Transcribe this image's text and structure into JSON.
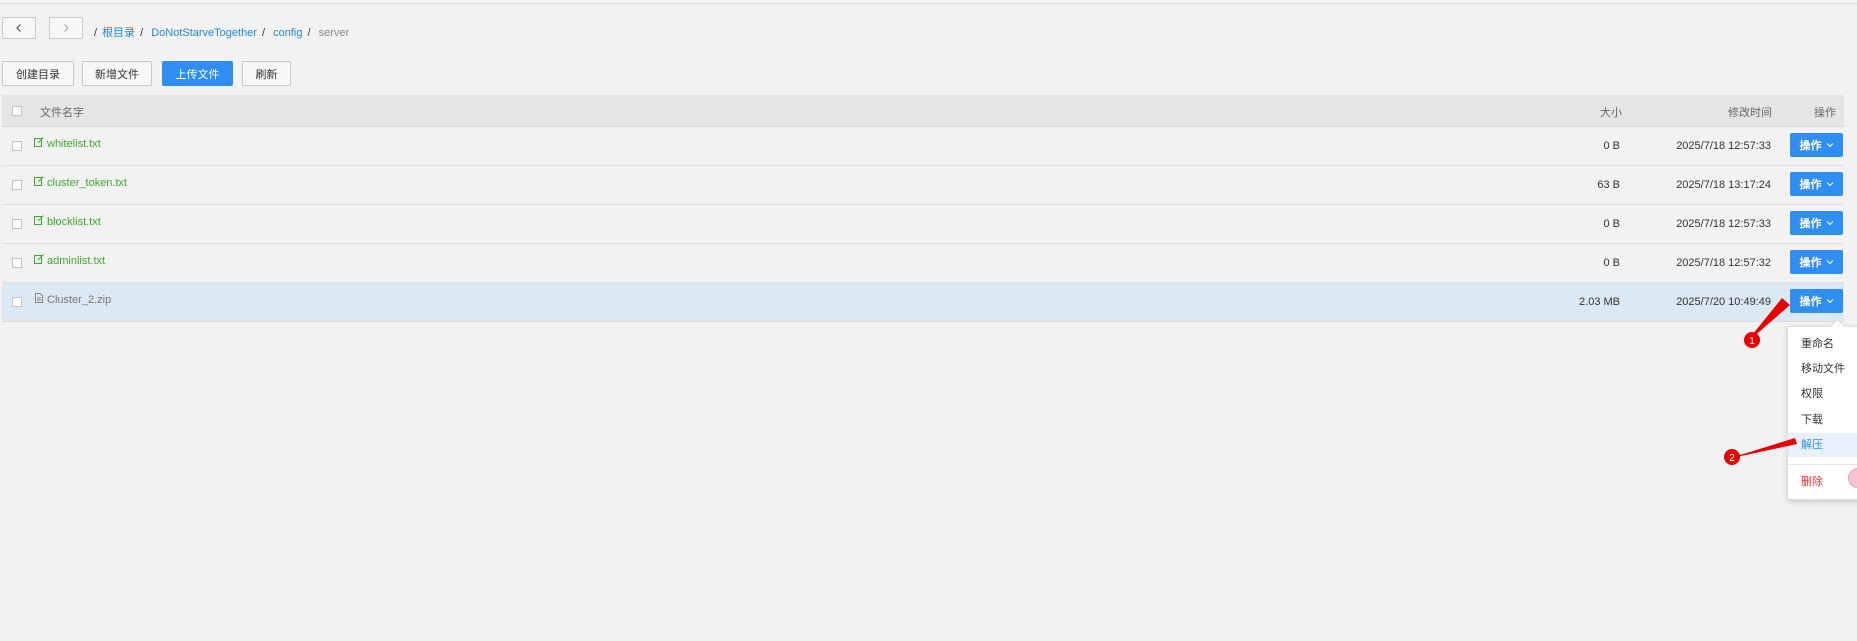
{
  "breadcrumb": {
    "root": "根目录",
    "items": [
      "DoNotStarveTogether",
      "config"
    ],
    "current": "server",
    "separator": "/"
  },
  "toolbar": {
    "create_dir": "创建目录",
    "new_file": "新增文件",
    "upload": "上传文件",
    "refresh": "刷新"
  },
  "table": {
    "headers": {
      "name": "文件名字",
      "size": "大小",
      "mtime": "修改时间",
      "action": "操作"
    },
    "rows": [
      {
        "name": "whitelist.txt",
        "size": "0 B",
        "mtime": "2025/7/18 12:57:33",
        "action": "操作",
        "icon": "edit-icon"
      },
      {
        "name": "cluster_token.txt",
        "size": "63 B",
        "mtime": "2025/7/18 13:17:24",
        "action": "操作",
        "icon": "edit-icon"
      },
      {
        "name": "blocklist.txt",
        "size": "0 B",
        "mtime": "2025/7/18 12:57:33",
        "action": "操作",
        "icon": "edit-icon"
      },
      {
        "name": "adminlist.txt",
        "size": "0 B",
        "mtime": "2025/7/18 12:57:32",
        "action": "操作",
        "icon": "edit-icon"
      },
      {
        "name": "Cluster_2.zip",
        "size": "2.03 MB",
        "mtime": "2025/7/20 10:49:49",
        "action": "操作",
        "icon": "file-icon",
        "highlighted": true
      }
    ]
  },
  "dropdown": {
    "items": [
      "重命名",
      "移动文件",
      "权限",
      "下载",
      "解压"
    ],
    "active": "解压",
    "danger_item": "删除"
  },
  "annotations": {
    "marker1": "1",
    "marker2": "2"
  },
  "colors": {
    "primary": "#2f8ef0",
    "link": "#1e88e5",
    "file_green": "#3eaa2b",
    "danger": "#e53935",
    "marker": "#e60000"
  }
}
